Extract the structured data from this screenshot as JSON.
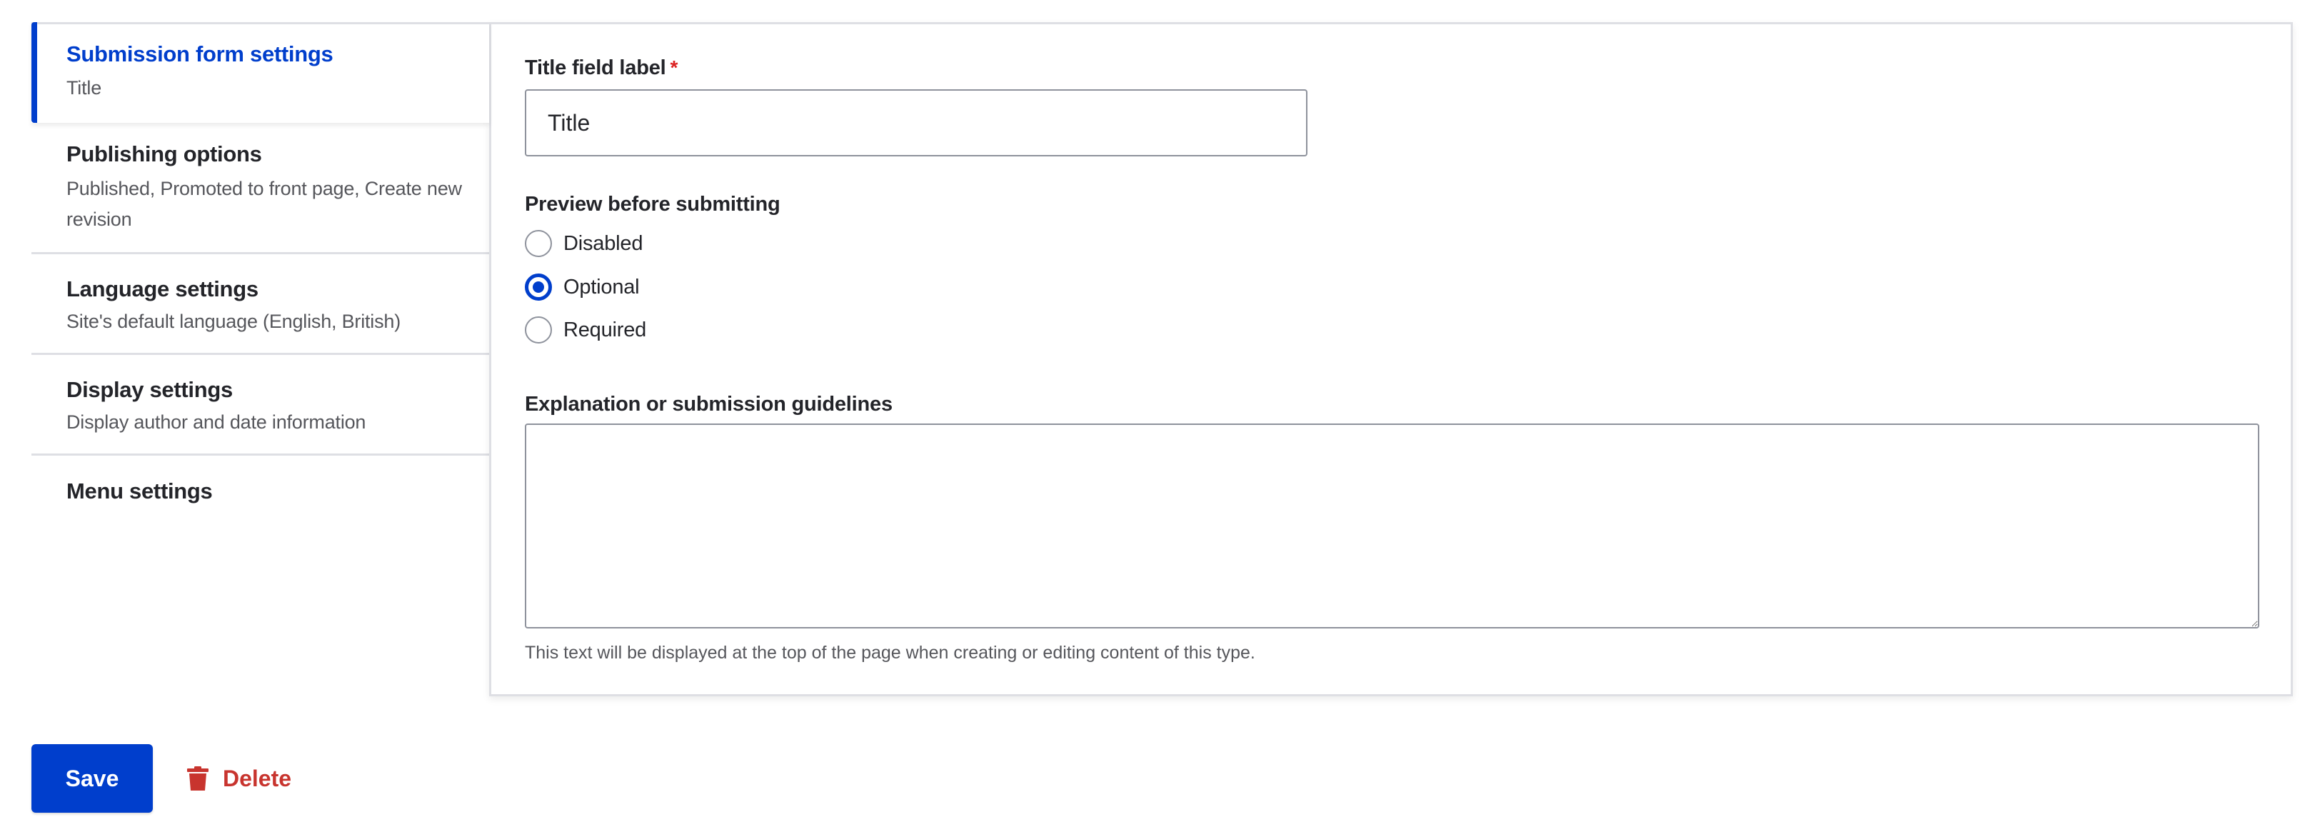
{
  "vertical_tabs": [
    {
      "title": "Submission form settings",
      "summary": "Title",
      "active": true
    },
    {
      "title": "Publishing options",
      "summary": "Published, Promoted to front page, Create new revision",
      "active": false
    },
    {
      "title": "Language settings",
      "summary": "Site's default language (English, British)",
      "active": false
    },
    {
      "title": "Display settings",
      "summary": "Display author and date information",
      "active": false
    },
    {
      "title": "Menu settings",
      "summary": "",
      "active": false
    }
  ],
  "form": {
    "title_field": {
      "label": "Title field label",
      "required_marker": "*",
      "value": "Title"
    },
    "preview": {
      "label": "Preview before submitting",
      "options": [
        "Disabled",
        "Optional",
        "Required"
      ],
      "selected": "Optional"
    },
    "guidelines": {
      "label": "Explanation or submission guidelines",
      "value": "",
      "help": "This text will be displayed at the top of the page when creating or editing content of this type."
    }
  },
  "actions": {
    "save_label": "Save",
    "delete_label": "Delete",
    "delete_icon": "trash-icon"
  },
  "colors": {
    "accent": "#003ecc",
    "danger": "#c8342e",
    "required": "#dc2323",
    "muted_text": "#55565b"
  }
}
